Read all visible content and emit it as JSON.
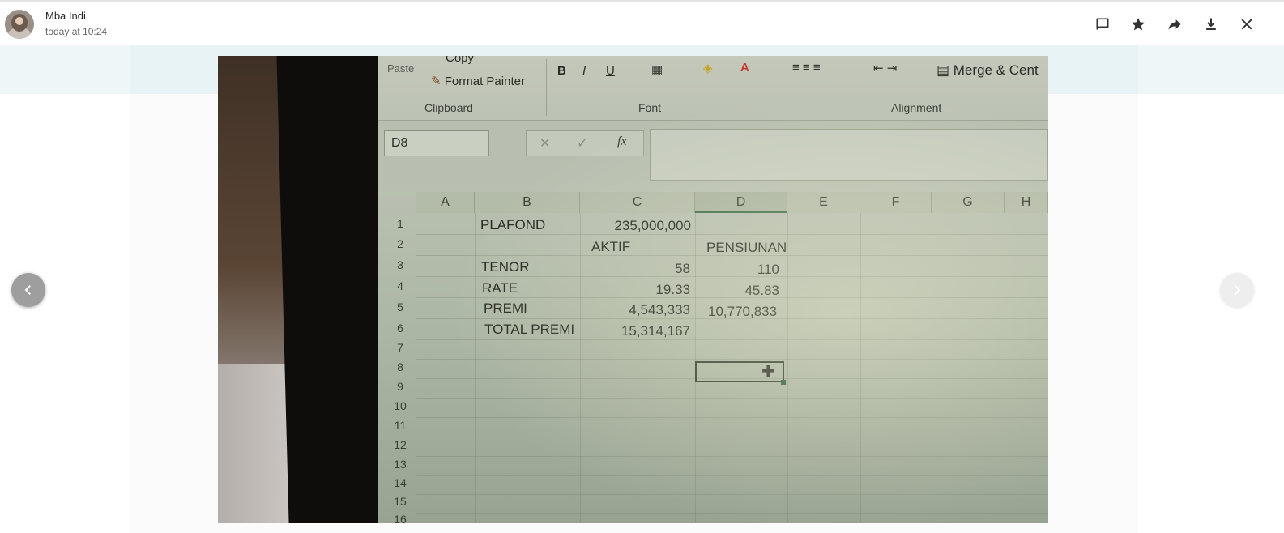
{
  "header": {
    "sender_name": "Mba Indi",
    "timestamp": "today at 10:24",
    "actions": [
      {
        "name": "comment-icon"
      },
      {
        "name": "star-icon"
      },
      {
        "name": "forward-icon"
      },
      {
        "name": "download-icon"
      },
      {
        "name": "close-icon"
      }
    ]
  },
  "viewer": {
    "prev_icon": "chevron-left-icon",
    "next_icon": "chevron-right-icon"
  },
  "photo": {
    "ribbon": {
      "copy": "Copy",
      "paste": "Paste",
      "format_painter": "Format Painter",
      "bold": "B",
      "italic": "I",
      "underline": "U",
      "font_color": "A",
      "merge": "Merge & Cent",
      "groups": {
        "clipboard": "Clipboard",
        "font": "Font",
        "alignment": "Alignment"
      }
    },
    "formula_bar": {
      "name_box": "D8",
      "fx": "fx",
      "value": ""
    },
    "columns": [
      "A",
      "B",
      "C",
      "D",
      "E",
      "F",
      "G",
      "H"
    ],
    "rows": [
      "1",
      "2",
      "3",
      "4",
      "5",
      "6",
      "7",
      "8",
      "9",
      "10",
      "11",
      "12",
      "13",
      "14",
      "15",
      "16"
    ],
    "cells": {
      "b1": "PLAFOND",
      "c1": "235,000,000",
      "c2": "AKTIF",
      "d2": "PENSIUNAN",
      "b3": "TENOR",
      "c3": "58",
      "d3": "110",
      "b4": "RATE",
      "c4": "19.33",
      "d4": "45.83",
      "b5": "PREMI",
      "c5": "4,543,333",
      "d5": "10,770,833",
      "b6": "TOTAL PREMI",
      "c6": "15,314,167"
    }
  }
}
